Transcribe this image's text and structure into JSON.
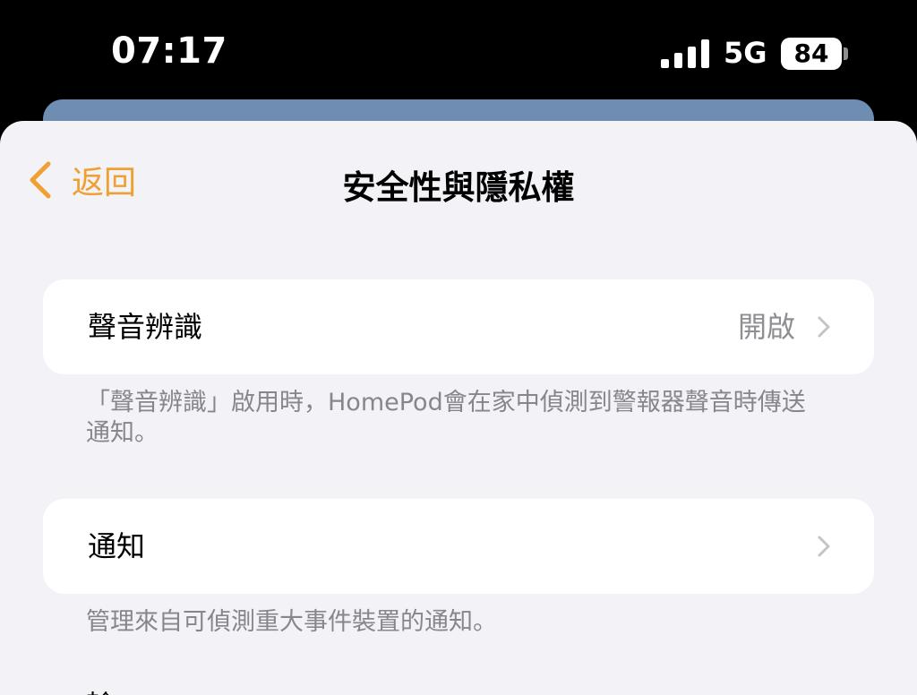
{
  "status_bar": {
    "time": "07:17",
    "network": "5G",
    "battery": "84",
    "signal_bars": 4
  },
  "nav": {
    "back_label": "返回",
    "title": "安全性與隱私權"
  },
  "rows": [
    {
      "label": "聲音辨識",
      "value": "開啟",
      "footer": "「聲音辨識」啟用時，HomePod會在家中偵測到警報器聲音時傳送通知。"
    },
    {
      "label": "通知",
      "value": "",
      "footer": "管理來自可偵測重大事件裝置的通知。"
    }
  ],
  "partial_row": "輸",
  "colors": {
    "accent": "#f0a030",
    "sheet_background": "#f2f2f7",
    "secondary_text": "#86868b",
    "underlying_card": "#6f8db2"
  },
  "icons": {
    "back": "chevron-left-icon",
    "disclosure": "chevron-right-icon",
    "signal": "cellular-signal-icon",
    "battery": "battery-icon"
  }
}
